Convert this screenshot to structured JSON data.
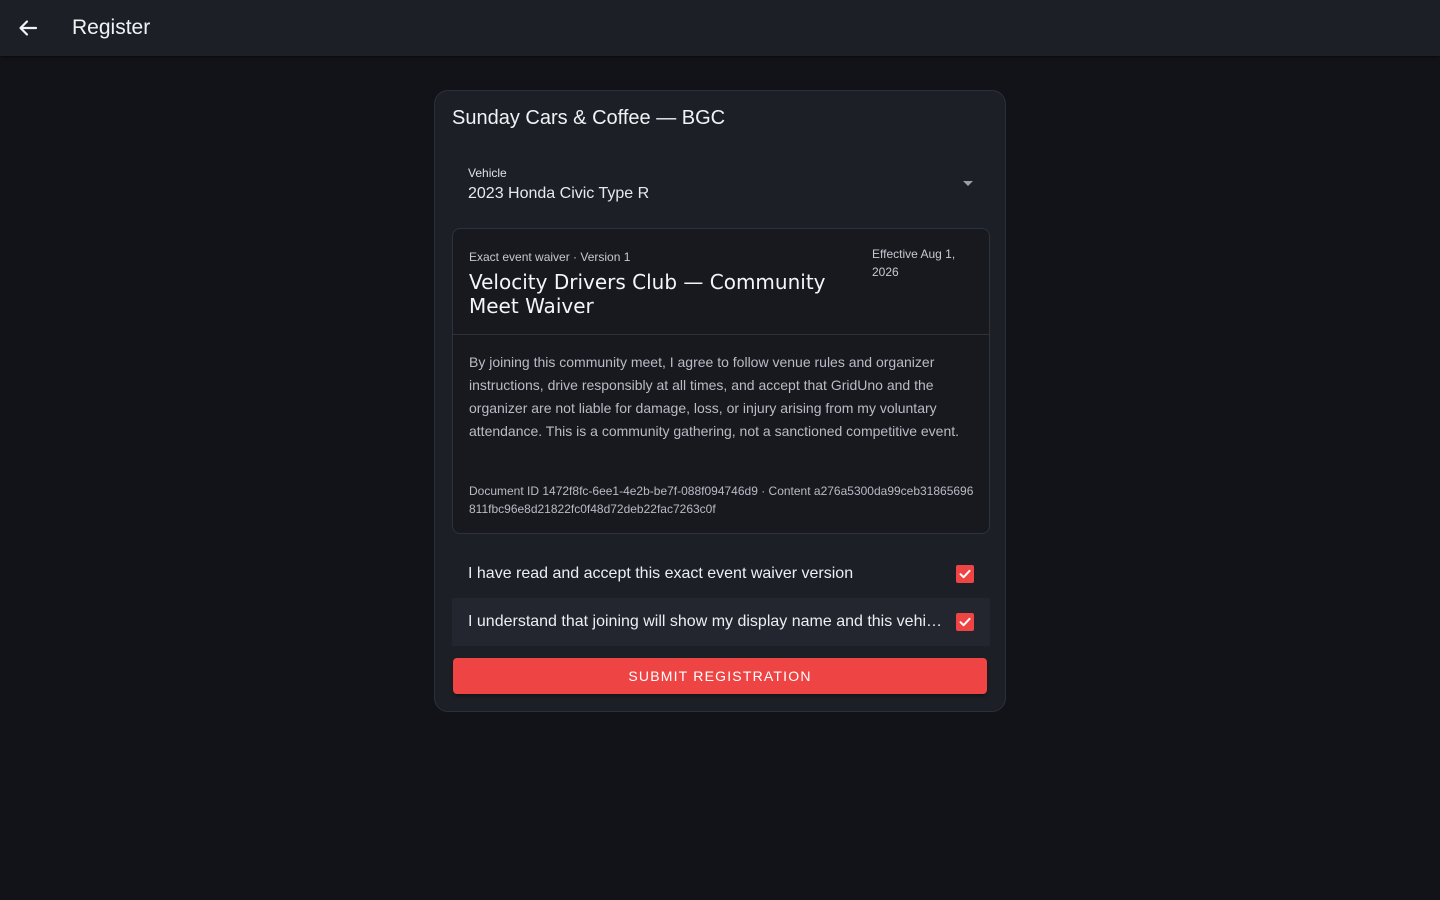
{
  "header": {
    "title": "Register",
    "back_icon": "arrow-left-icon"
  },
  "event": {
    "title": "Sunday Cars & Coffee — BGC"
  },
  "vehicle": {
    "label": "Vehicle",
    "value": "2023 Honda Civic Type R"
  },
  "waiver": {
    "overline": "Exact event waiver · Version 1",
    "title": "Velocity Drivers Club — Community Meet Waiver",
    "effective": "Effective Aug 1, 2026",
    "body": "By joining this community meet, I agree to follow venue rules and organizer instructions, drive responsibly at all times, and accept that GridUno and the organizer are not liable for damage, loss, or injury arising from my voluntary attendance. This is a community gathering, not a sanctioned competitive event.",
    "meta": "Document ID 1472f8fc-6ee1-4e2b-be7f-088f094746d9 · Content a276a5300da99ceb31865696811fbc96e8d21822fc0f48d72deb22fac7263c0f"
  },
  "consents": [
    {
      "label": "I have read and accept this exact event waiver version",
      "checked": true
    },
    {
      "label": "I understand that joining will show my display name and this vehicle to other attendees",
      "checked": true
    }
  ],
  "submit": {
    "label": "SUBMIT REGISTRATION"
  },
  "colors": {
    "accent": "#ef4444",
    "background": "#121318",
    "surface": "#1c1f26"
  }
}
